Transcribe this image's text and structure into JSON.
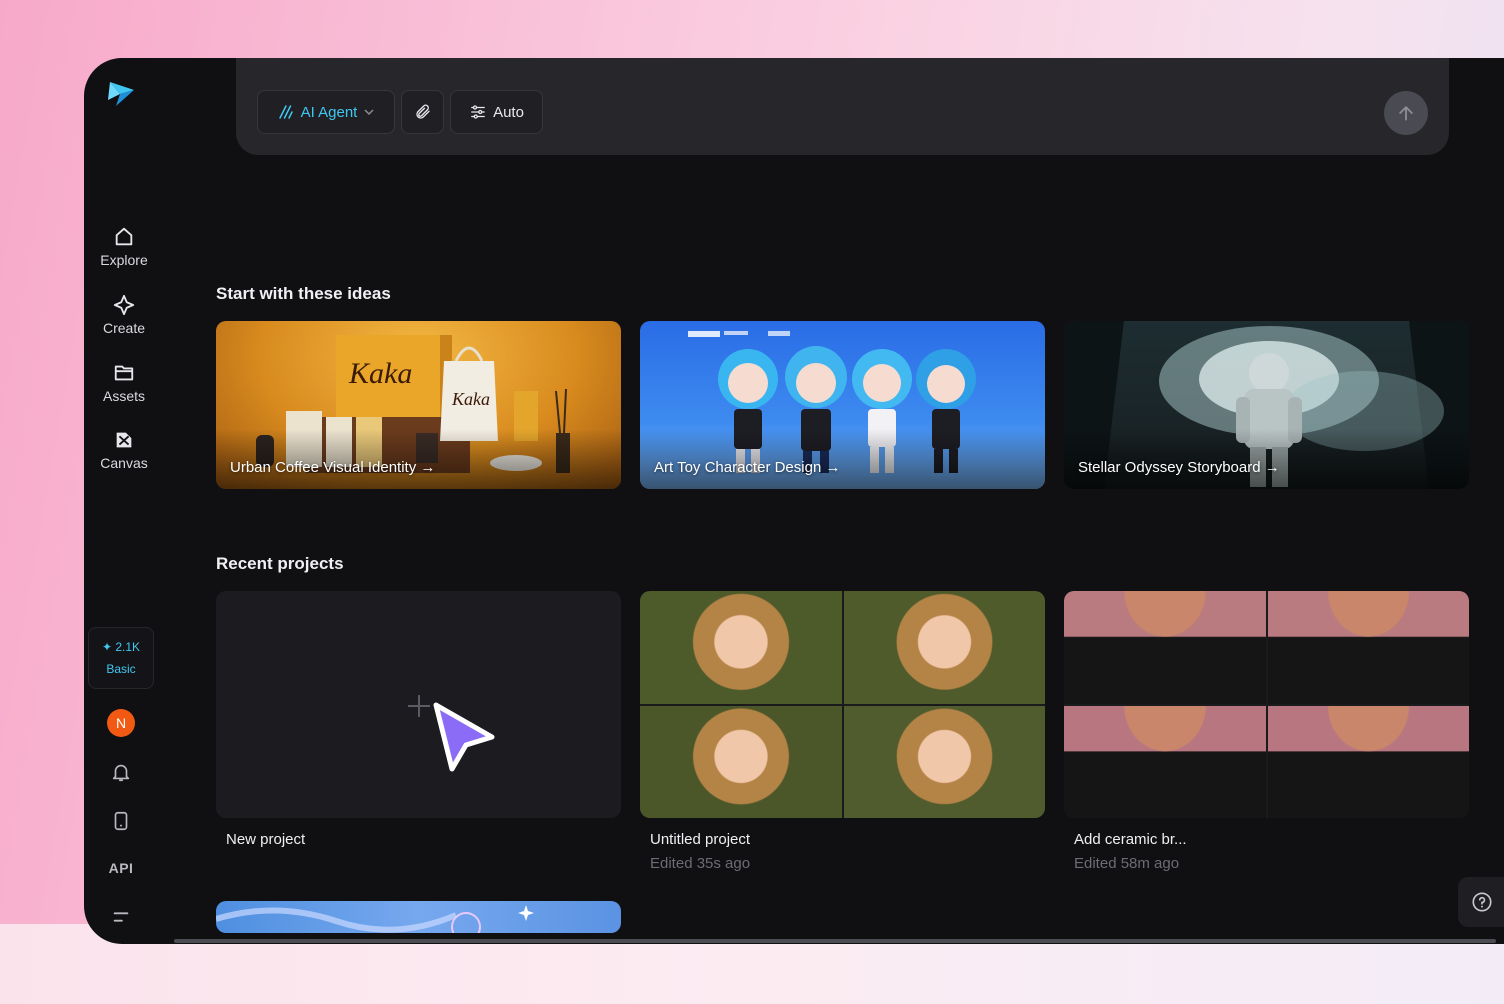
{
  "sidebar": {
    "items": [
      {
        "label": "Explore",
        "icon": "home-icon"
      },
      {
        "label": "Create",
        "icon": "sparkle-icon"
      },
      {
        "label": "Assets",
        "icon": "folder-icon"
      },
      {
        "label": "Canvas",
        "icon": "canvas-icon"
      }
    ],
    "credits": {
      "amount": "2.1K",
      "plan": "Basic"
    },
    "avatar_initial": "N",
    "api_label": "API"
  },
  "prompt": {
    "agent_label": "AI Agent",
    "auto_label": "Auto"
  },
  "ideas": {
    "title": "Start with these ideas",
    "cards": [
      {
        "caption": "Urban Coffee Visual Identity"
      },
      {
        "caption": "Art Toy Character Design"
      },
      {
        "caption": "Stellar Odyssey Storyboard"
      }
    ]
  },
  "recent": {
    "title": "Recent projects",
    "projects": [
      {
        "name": "New project",
        "time": ""
      },
      {
        "name": "Untitled project",
        "time": "Edited 35s ago"
      },
      {
        "name": "Add ceramic br...",
        "time": "Edited 58m ago"
      }
    ]
  },
  "colors": {
    "accent": "#3fc7f2",
    "background": "#101013",
    "avatar": "#f25a13",
    "cursor": "#8b6cf6"
  }
}
